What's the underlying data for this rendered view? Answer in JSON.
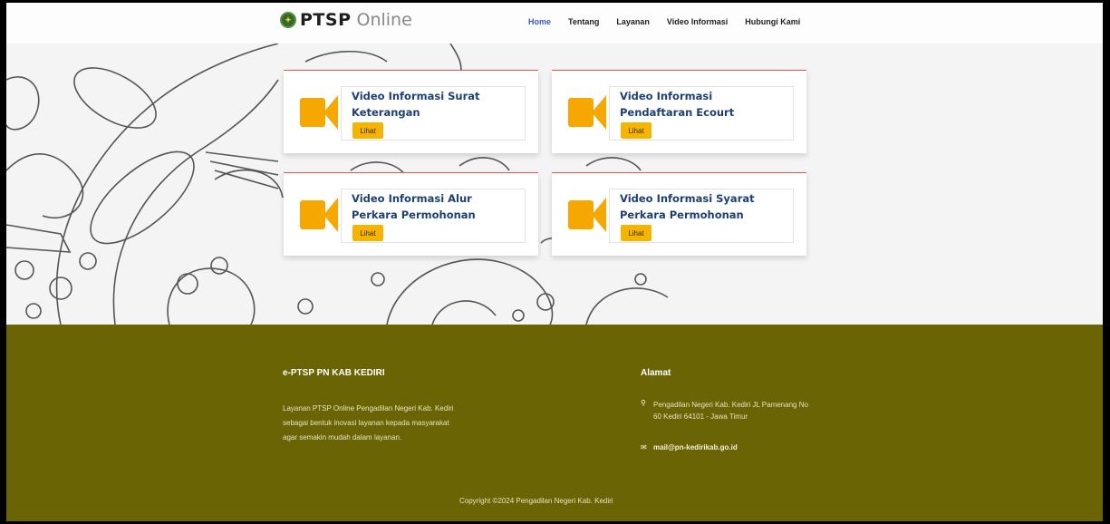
{
  "header": {
    "brand_bold": "PTSP",
    "brand_light": "Online",
    "nav": [
      {
        "label": "Home",
        "active": true
      },
      {
        "label": "Tentang"
      },
      {
        "label": "Layanan"
      },
      {
        "label": "Video Informasi"
      },
      {
        "label": "Hubungi Kami"
      }
    ]
  },
  "cards": [
    {
      "title": "Video Informasi Surat Keterangan",
      "button": "Lihat",
      "icon": "video-camera-icon"
    },
    {
      "title": "Video Informasi Pendaftaran Ecourt",
      "button": "Lihat",
      "icon": "video-camera-icon"
    },
    {
      "title": "Video Informasi Alur Perkara Permohonan",
      "button": "Lihat",
      "icon": "video-camera-icon"
    },
    {
      "title": "Video Informasi Syarat Perkara Permohonan",
      "button": "Lihat",
      "icon": "video-camera-icon"
    }
  ],
  "footer": {
    "left_title": "e-PTSP PN KAB KEDIRI",
    "left_desc": "Layanan PTSP Online Pengadilan Negeri Kab. Kediri sebagai bentuk inovasi layanan kepada masyarakat agar semakin mudah dalam layanan.",
    "right_title": "Alamat",
    "address": "Pengadilan Negeri Kab. Kediri JL Pamenang No 60 Kediri 64101 - Jawa Timur",
    "email": "mail@pn-kedirikab.go.id",
    "copyright": "Copyright ©2024 Pengadilan Negeri Kab. Kediri"
  },
  "colors": {
    "accent_nav": "#3a56c8",
    "button": "#f4b400",
    "icon": "#f7a800",
    "footer_bg": "#6b6405",
    "card_title": "#1d3f72"
  }
}
